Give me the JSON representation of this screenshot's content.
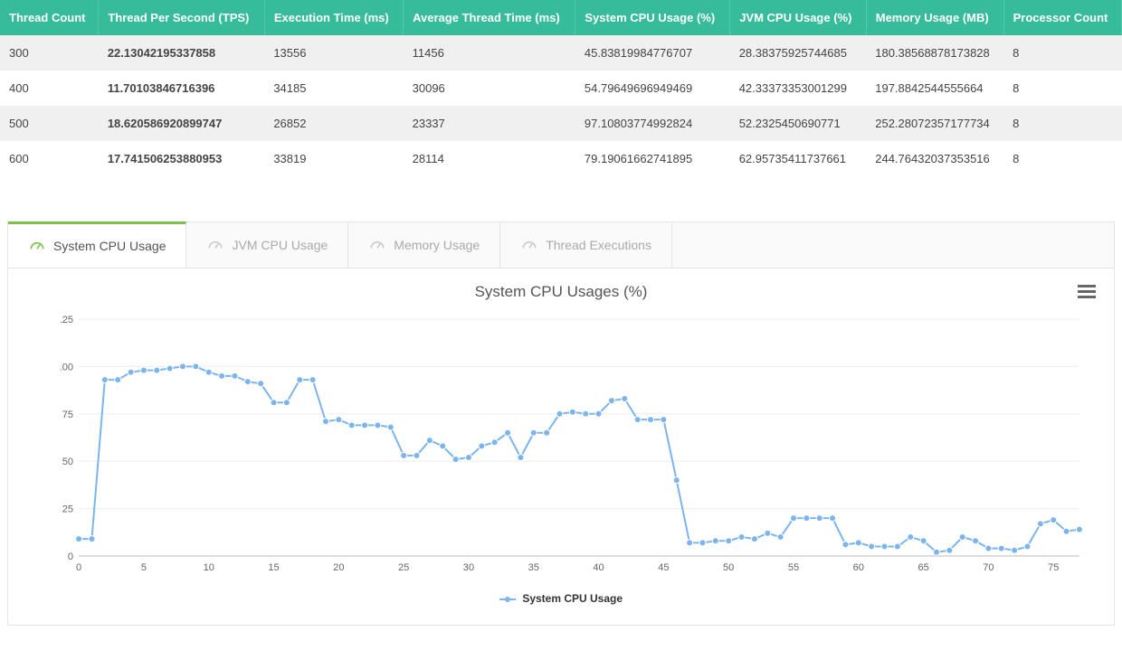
{
  "table": {
    "headers": [
      "Thread Count",
      "Thread Per Second (TPS)",
      "Execution Time (ms)",
      "Average Thread Time (ms)",
      "System CPU Usage (%)",
      "JVM CPU Usage (%)",
      "Memory Usage (MB)",
      "Processor Count"
    ],
    "rows": [
      {
        "count": "300",
        "tps": "22.13042195337858",
        "exec": "13556",
        "avg": "11456",
        "sys": "45.83819984776707",
        "jvm": "28.38375925744685",
        "mem": "180.38568878173828",
        "proc": "8"
      },
      {
        "count": "400",
        "tps": "11.70103846716396",
        "exec": "34185",
        "avg": "30096",
        "sys": "54.79649696949469",
        "jvm": "42.33373353001299",
        "mem": "197.8842544555664",
        "proc": "8"
      },
      {
        "count": "500",
        "tps": "18.620586920899747",
        "exec": "26852",
        "avg": "23337",
        "sys": "97.10803774992824",
        "jvm": "52.2325450690771",
        "mem": "252.28072357177734",
        "proc": "8"
      },
      {
        "count": "600",
        "tps": "17.741506253880953",
        "exec": "33819",
        "avg": "28114",
        "sys": "79.19061662741895",
        "jvm": "62.95735411737661",
        "mem": "244.76432037353516",
        "proc": "8"
      }
    ]
  },
  "tabs": [
    {
      "label": "System CPU Usage",
      "active": true
    },
    {
      "label": "JVM CPU Usage",
      "active": false
    },
    {
      "label": "Memory Usage",
      "active": false
    },
    {
      "label": "Thread Executions",
      "active": false
    }
  ],
  "chart_data": {
    "type": "line",
    "title": "System CPU Usages (%)",
    "xlabel": "",
    "ylabel": "",
    "ylim": [
      0,
      125
    ],
    "x_ticks": [
      0,
      5,
      10,
      15,
      20,
      25,
      30,
      35,
      40,
      45,
      50,
      55,
      60,
      65,
      70,
      75
    ],
    "series": [
      {
        "name": "System CPU Usage",
        "color": "#7cb5ec",
        "x": [
          0,
          1,
          2,
          3,
          4,
          5,
          6,
          7,
          8,
          9,
          10,
          11,
          12,
          13,
          14,
          15,
          16,
          17,
          18,
          19,
          20,
          21,
          22,
          23,
          24,
          25,
          26,
          27,
          28,
          29,
          30,
          31,
          32,
          33,
          34,
          35,
          36,
          37,
          38,
          39,
          40,
          41,
          42,
          43,
          44,
          45,
          46,
          47,
          48,
          49,
          50,
          51,
          52,
          53,
          54,
          55,
          56,
          57,
          58,
          59,
          60,
          61,
          62,
          63,
          64,
          65,
          66,
          67,
          68,
          69,
          70,
          71,
          72,
          73,
          74,
          75,
          76,
          77
        ],
        "values": [
          9,
          9,
          93,
          93,
          97,
          98,
          98,
          99,
          100,
          100,
          97,
          95,
          95,
          92,
          91,
          81,
          81,
          93,
          93,
          71,
          72,
          69,
          69,
          69,
          68,
          53,
          53,
          61,
          58,
          51,
          52,
          58,
          60,
          65,
          52,
          65,
          65,
          75,
          76,
          75,
          75,
          82,
          83,
          72,
          72,
          72,
          40,
          7,
          7,
          8,
          8,
          10,
          9,
          12,
          10,
          20,
          20,
          20,
          20,
          6,
          7,
          5,
          5,
          5,
          10,
          8,
          2,
          3,
          10,
          8,
          4,
          4,
          3,
          5,
          17,
          19,
          13,
          14
        ]
      }
    ],
    "legend": "System CPU Usage"
  }
}
